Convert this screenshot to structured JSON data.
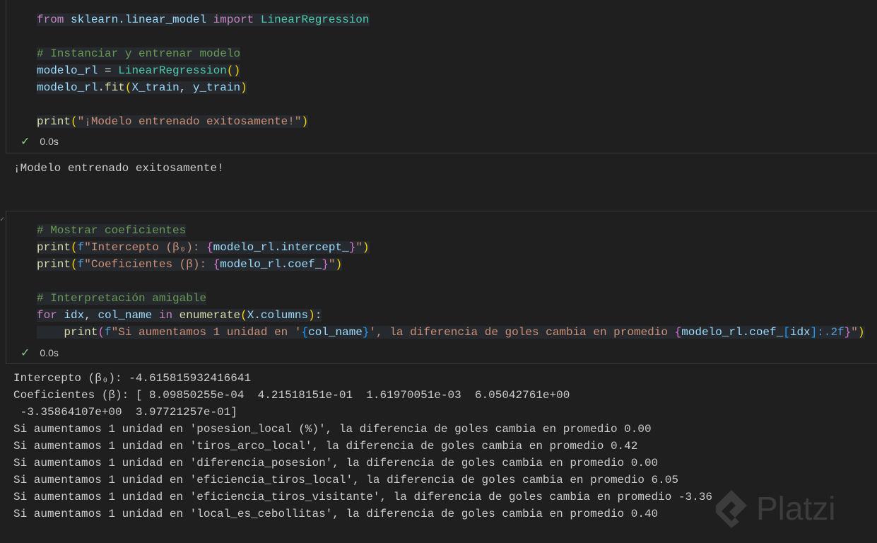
{
  "cells": [
    {
      "lines": [
        [
          [
            "from",
            "kw"
          ],
          [
            " ",
            "pl"
          ],
          [
            "sklearn.linear_model",
            "mod"
          ],
          [
            " ",
            "pl"
          ],
          [
            "import",
            "kw"
          ],
          [
            " ",
            "pl"
          ],
          [
            "LinearRegression",
            "cls"
          ]
        ],
        [],
        [
          [
            "# Instanciar y entrenar modelo",
            "cm"
          ]
        ],
        [
          [
            "modelo_rl",
            "var"
          ],
          [
            " = ",
            "op"
          ],
          [
            "LinearRegression",
            "cls"
          ],
          [
            "()",
            "br"
          ]
        ],
        [
          [
            "modelo_rl",
            "var"
          ],
          [
            ".",
            "pl"
          ],
          [
            "fit",
            "fn"
          ],
          [
            "(",
            "br"
          ],
          [
            "X_train",
            "var"
          ],
          [
            ", ",
            "pl"
          ],
          [
            "y_train",
            "var"
          ],
          [
            ")",
            "br"
          ]
        ],
        [],
        [
          [
            "print",
            "fn"
          ],
          [
            "(",
            "br"
          ],
          [
            "\"¡Modelo entrenado exitosamente!\"",
            "str"
          ],
          [
            ")",
            "br"
          ]
        ]
      ],
      "status": "0.0s",
      "output": [
        "¡Modelo entrenado exitosamente!"
      ]
    },
    {
      "lines": [
        [
          [
            "# Mostrar coeficientes",
            "cm"
          ]
        ],
        [
          [
            "print",
            "fn"
          ],
          [
            "(",
            "br"
          ],
          [
            "f",
            "fmt"
          ],
          [
            "\"Intercepto (β₀): ",
            "str"
          ],
          [
            "{",
            "br2"
          ],
          [
            "modelo_rl.intercept_",
            "var"
          ],
          [
            "}",
            "br2"
          ],
          [
            "\"",
            "str"
          ],
          [
            ")",
            "br"
          ]
        ],
        [
          [
            "print",
            "fn"
          ],
          [
            "(",
            "br"
          ],
          [
            "f",
            "fmt"
          ],
          [
            "\"Coeficientes (β): ",
            "str"
          ],
          [
            "{",
            "br2"
          ],
          [
            "modelo_rl.coef_",
            "var"
          ],
          [
            "}",
            "br2"
          ],
          [
            "\"",
            "str"
          ],
          [
            ")",
            "br"
          ]
        ],
        [],
        [
          [
            "# Interpretación amigable",
            "cm"
          ]
        ],
        [
          [
            "for",
            "kw"
          ],
          [
            " ",
            "pl"
          ],
          [
            "idx",
            "var"
          ],
          [
            ", ",
            "pl"
          ],
          [
            "col_name",
            "var"
          ],
          [
            " ",
            "pl"
          ],
          [
            "in",
            "kw"
          ],
          [
            " ",
            "pl"
          ],
          [
            "enumerate",
            "fn"
          ],
          [
            "(",
            "br"
          ],
          [
            "X",
            "var"
          ],
          [
            ".",
            "pl"
          ],
          [
            "columns",
            "var"
          ],
          [
            ")",
            "br"
          ],
          [
            ":",
            "pl"
          ]
        ],
        [
          [
            "    ",
            "pl"
          ],
          [
            "print",
            "fn"
          ],
          [
            "(",
            "br2"
          ],
          [
            "f",
            "fmt"
          ],
          [
            "\"Si aumentamos 1 unidad en '",
            "str"
          ],
          [
            "{",
            "br3"
          ],
          [
            "col_name",
            "var"
          ],
          [
            "}",
            "br3"
          ],
          [
            "', la diferencia de goles cambia en promedio ",
            "str"
          ],
          [
            "{",
            "br2"
          ],
          [
            "modelo_rl.coef_",
            "var"
          ],
          [
            "[",
            "br3"
          ],
          [
            "idx",
            "var"
          ],
          [
            "]",
            "br3"
          ],
          [
            ":.2f",
            "fmt"
          ],
          [
            "}",
            "br2"
          ],
          [
            "\"",
            "str"
          ],
          [
            ")",
            "br"
          ]
        ]
      ],
      "status": "0.0s",
      "output": [
        "Intercepto (β₀): -4.615815932416641",
        "Coeficientes (β): [ 8.09850255e-04  4.21518151e-01  1.61970051e-03  6.05042761e+00",
        " -3.35864107e+00  3.97721257e-01]",
        "Si aumentamos 1 unidad en 'posesion_local (%)', la diferencia de goles cambia en promedio 0.00",
        "Si aumentamos 1 unidad en 'tiros_arco_local', la diferencia de goles cambia en promedio 0.42",
        "Si aumentamos 1 unidad en 'diferencia_posesion', la diferencia de goles cambia en promedio 0.00",
        "Si aumentamos 1 unidad en 'eficiencia_tiros_local', la diferencia de goles cambia en promedio 6.05",
        "Si aumentamos 1 unidad en 'eficiencia_tiros_visitante', la diferencia de goles cambia en promedio -3.36",
        "Si aumentamos 1 unidad en 'local_es_cebollitas', la diferencia de goles cambia en promedio 0.40"
      ]
    }
  ],
  "watermark": "Platzi"
}
